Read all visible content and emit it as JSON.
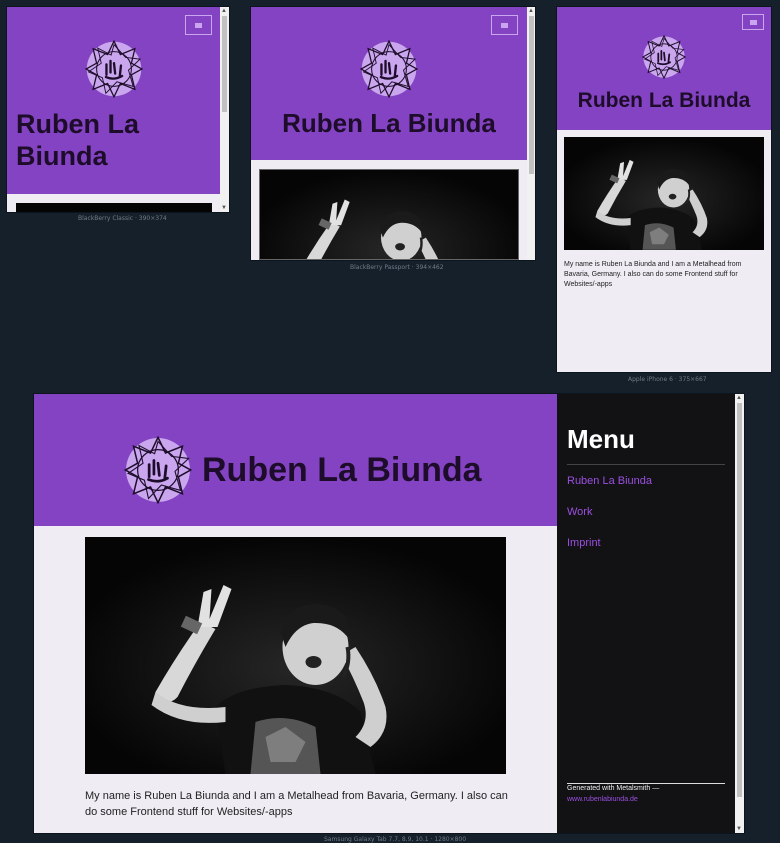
{
  "site": {
    "title": "Ruben La Biunda",
    "bio": "My name is Ruben La Biunda and I am a Metalhead from Bavaria, Germany. I also can do some Frontend stuff for Websites/-apps",
    "accent": "#8443c2",
    "link_color": "#9b4fe0"
  },
  "menu": {
    "heading": "Menu",
    "items": [
      {
        "label": "Ruben La Biunda"
      },
      {
        "label": "Work"
      },
      {
        "label": "Imprint"
      }
    ],
    "footer_text": "Generated with Metalsmith —",
    "footer_link": "www.rubenlabiunda.de"
  },
  "devices": [
    {
      "caption": "BlackBerry Classic · 390×374"
    },
    {
      "caption": "BlackBerry Passport · 394×462"
    },
    {
      "caption": "Apple iPhone 6 · 375×667"
    },
    {
      "caption": "Samsung Galaxy Tab 7.7, 8.9, 10.1 · 1280×800"
    }
  ],
  "icons": {
    "menu_button": "menu-icon",
    "logo": "star-emblem-icon",
    "photo": "portrait-photo"
  }
}
